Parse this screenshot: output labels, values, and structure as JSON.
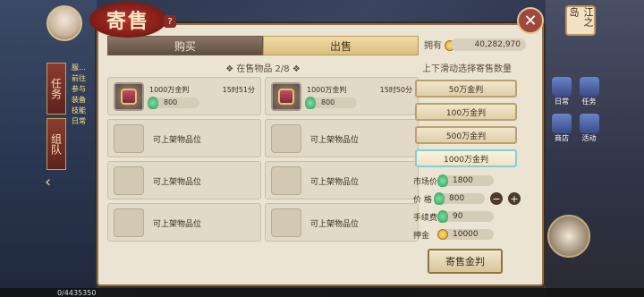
{
  "header": {
    "title": "寄售",
    "help": "?"
  },
  "tabs": {
    "buy": "购买",
    "sell": "出售"
  },
  "owned": {
    "label": "拥有",
    "value": "40,282,970"
  },
  "on_sale": {
    "label": "在售物品 2/8"
  },
  "listings": [
    {
      "name": "1000万金判",
      "time": "15时51分",
      "price": "800",
      "filled": true
    },
    {
      "name": "1000万金判",
      "time": "15时50分",
      "price": "800",
      "filled": true
    },
    {
      "name": "可上架物品位",
      "filled": false
    },
    {
      "name": "可上架物品位",
      "filled": false
    },
    {
      "name": "可上架物品位",
      "filled": false
    },
    {
      "name": "可上架物品位",
      "filled": false
    },
    {
      "name": "可上架物品位",
      "filled": false
    },
    {
      "name": "可上架物品位",
      "filled": false
    }
  ],
  "select": {
    "title": "上下滑动选择寄售数量",
    "options": [
      "50万金判",
      "100万金判",
      "500万金判",
      "1000万金判"
    ],
    "selected": "1000万金判"
  },
  "stats": {
    "market_label": "市场价",
    "market_value": "1800",
    "price_label": "价  格",
    "price_value": "800",
    "fee_label": "手续费",
    "fee_value": "90",
    "deposit_label": "押金",
    "deposit_value": "10000"
  },
  "consign_button": "寄售金判",
  "side": {
    "task_tab": "任务",
    "team_tab": "组队",
    "task_list": [
      "服…",
      "前往",
      "参与",
      "装备",
      "技能",
      "日常"
    ]
  },
  "right": {
    "map_name": "江之岛",
    "icons": [
      "日常",
      "任务",
      "商店",
      "活动"
    ]
  },
  "bottom_text": "0/4435350"
}
